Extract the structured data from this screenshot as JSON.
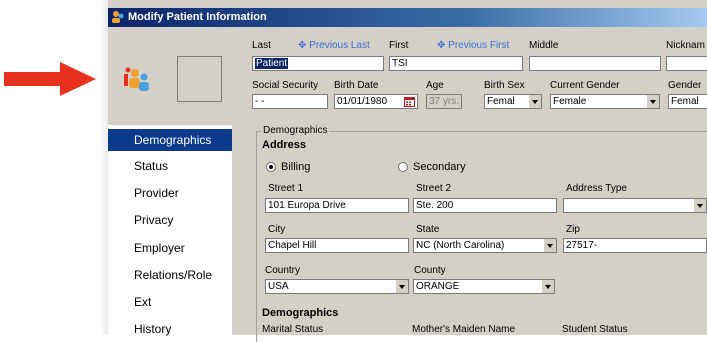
{
  "window": {
    "title": "Modify Patient Information"
  },
  "header": {
    "last_label": "Last",
    "prev_last_link": "✥ Previous Last",
    "first_label": "First",
    "prev_first_link": "✥ Previous First",
    "middle_label": "Middle",
    "nickname_label": "Nicknam",
    "last_value": "Patient",
    "first_value": "TSI",
    "middle_value": "",
    "nickname_value": "",
    "ssn_label": "Social Security",
    "ssn_value": " - -",
    "birthdate_label": "Birth Date",
    "birthdate_value": "01/01/1980",
    "age_label": "Age",
    "age_value": "37 yrs.",
    "birthsex_label": "Birth Sex",
    "birthsex_value": "Femal",
    "current_gender_label": "Current Gender",
    "current_gender_value": "Female",
    "gender_label": "Gender",
    "gender_value": "Femal"
  },
  "sidebar": {
    "items": [
      {
        "label": "Demographics",
        "active": true
      },
      {
        "label": "Status"
      },
      {
        "label": "Provider"
      },
      {
        "label": "Privacy"
      },
      {
        "label": "Employer"
      },
      {
        "label": "Relations/Role"
      },
      {
        "label": "Ext"
      },
      {
        "label": "History"
      }
    ]
  },
  "demographics": {
    "group_title": "Demographics",
    "address_heading": "Address",
    "billing_label": "Billing",
    "secondary_label": "Secondary",
    "street1_label": "Street 1",
    "street1_value": "101 Europa Drive",
    "street2_label": "Street 2",
    "street2_value": "Ste. 200",
    "address_type_label": "Address Type",
    "address_type_value": "",
    "city_label": "City",
    "city_value": "Chapel Hill",
    "state_label": "State",
    "state_value": "NC  (North Carolina)",
    "zip_label": "Zip",
    "zip_value": "27517-",
    "country_label": "Country",
    "country_value": "USA",
    "county_label": "County",
    "county_value": "ORANGE",
    "demographics_heading": "Demographics",
    "marital_label": "Marital Status",
    "maiden_label": "Mother's Maiden Name",
    "student_label": "Student Status"
  },
  "colors": {
    "arrow": "#e8321e",
    "active_nav": "#0a3a8c",
    "titlebar": "#0a246a",
    "link": "#3b6fd6"
  }
}
